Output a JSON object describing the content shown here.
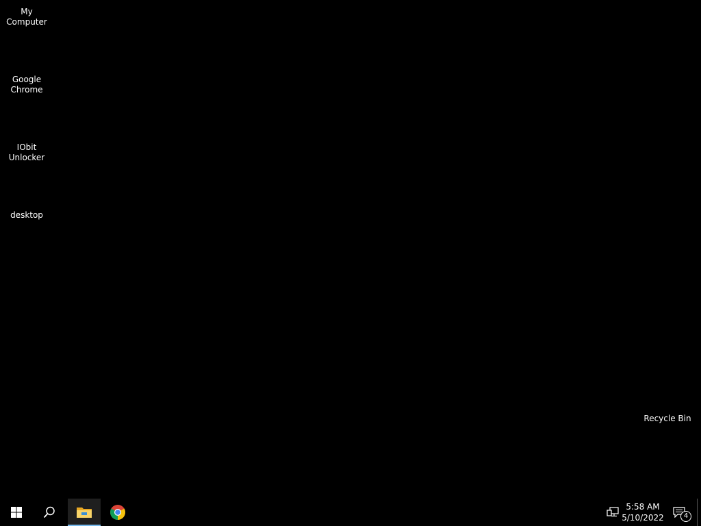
{
  "desktop": {
    "icons": [
      {
        "label": "My Computer"
      },
      {
        "label": "Google\nChrome"
      },
      {
        "label": "IObit\nUnlocker"
      },
      {
        "label": "desktop"
      },
      {
        "label": "Recycle Bin"
      }
    ]
  },
  "taskbar": {
    "start_icon": "windows-logo-icon",
    "search_icon": "search-icon",
    "pinned": [
      {
        "name": "File Explorer",
        "icon": "folder-icon",
        "active": true
      },
      {
        "name": "Google Chrome",
        "icon": "chrome-icon",
        "active": false
      }
    ],
    "tray": {
      "network_icon": "network-icon",
      "time": "5:58 AM",
      "date": "5/10/2022",
      "notification_count": "4"
    }
  },
  "colors": {
    "background": "#000000",
    "taskbar": "#000000",
    "text": "#ffffff",
    "active_indicator": "#76b9ed"
  }
}
